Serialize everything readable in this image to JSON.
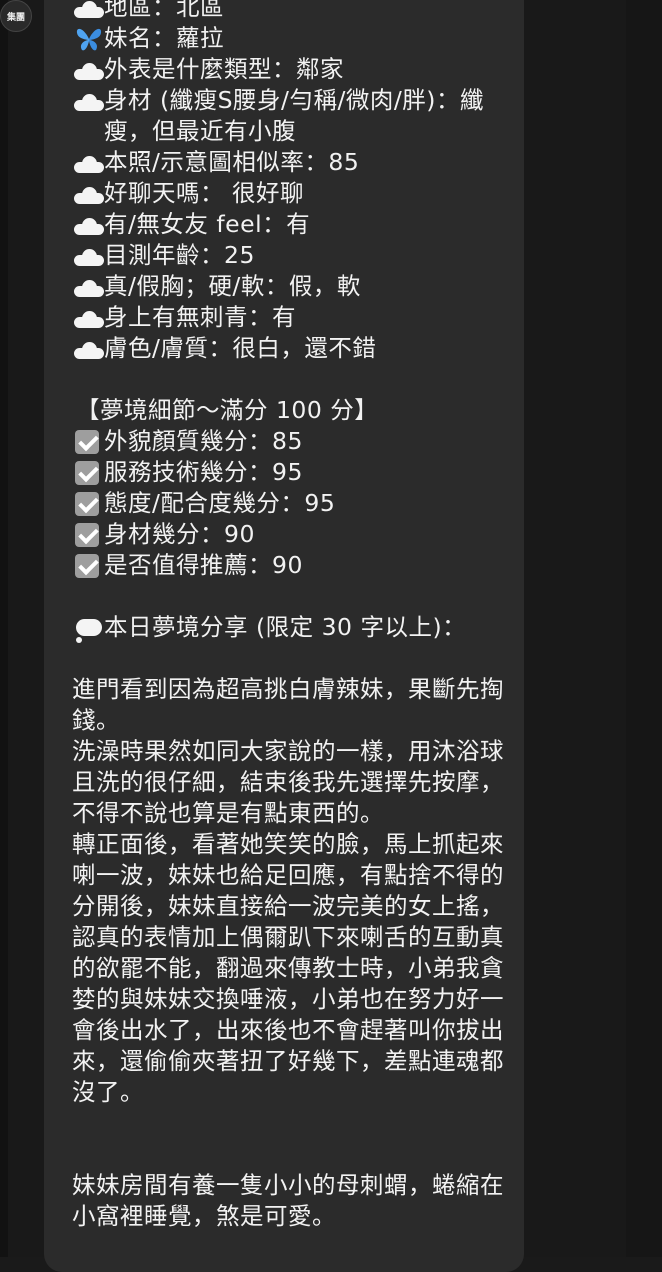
{
  "avatar": {
    "label": "集團"
  },
  "profile": [
    {
      "icon": "cloud-icon",
      "text": "地區：北區"
    },
    {
      "icon": "butterfly-icon",
      "text": "妹名：蘿拉"
    },
    {
      "icon": "cloud-icon",
      "text": "外表是什麼類型：鄰家"
    },
    {
      "icon": "cloud-icon",
      "text": "身材 (纖瘦S腰身/勻稱/微肉/胖)：纖瘦，但最近有小腹"
    },
    {
      "icon": "cloud-icon",
      "text": "本照/示意圖相似率：85"
    },
    {
      "icon": "cloud-icon",
      "text": "好聊天嗎： 很好聊"
    },
    {
      "icon": "cloud-icon",
      "text": "有/無女友 feel：有"
    },
    {
      "icon": "cloud-icon",
      "text": "目測年齡：25"
    },
    {
      "icon": "cloud-icon",
      "text": "真/假胸；硬/軟：假，軟"
    },
    {
      "icon": "cloud-icon",
      "text": "身上有無刺青：有"
    },
    {
      "icon": "cloud-icon",
      "text": "膚色/膚質：很白，還不錯"
    }
  ],
  "scores_header": "【夢境細節～滿分 100 分】",
  "scores": [
    {
      "text": "外貌顏質幾分：85"
    },
    {
      "text": "服務技術幾分：95"
    },
    {
      "text": "態度/配合度幾分：95"
    },
    {
      "text": "身材幾分：90"
    },
    {
      "text": "是否值得推薦：90"
    }
  ],
  "share_header": "本日夢境分享 (限定 30 字以上)：",
  "paragraphs": [
    "進門看到因為超高挑白膚辣妹，果斷先掏錢。",
    "洗澡時果然如同大家說的一樣，用沐浴球且洗的很仔細，結束後我先選擇先按摩，不得不說也算是有點東西的。",
    "轉正面後，看著她笑笑的臉，馬上抓起來喇一波，妹妹也給足回應，有點捨不得的分開後，妹妹直接給一波完美的女上搖，認真的表情加上偶爾趴下來喇舌的互動真的欲罷不能，翻過來傳教士時，小弟我貪婪的與妹妹交換唾液，小弟也在努力好一會後出水了，出來後也不會趕著叫你拔出來，還偷偷夾著扭了好幾下，差點連魂都沒了。",
    "妹妹房間有養一隻小小的母刺蝟，蜷縮在小窩裡睡覺，煞是可愛。"
  ]
}
